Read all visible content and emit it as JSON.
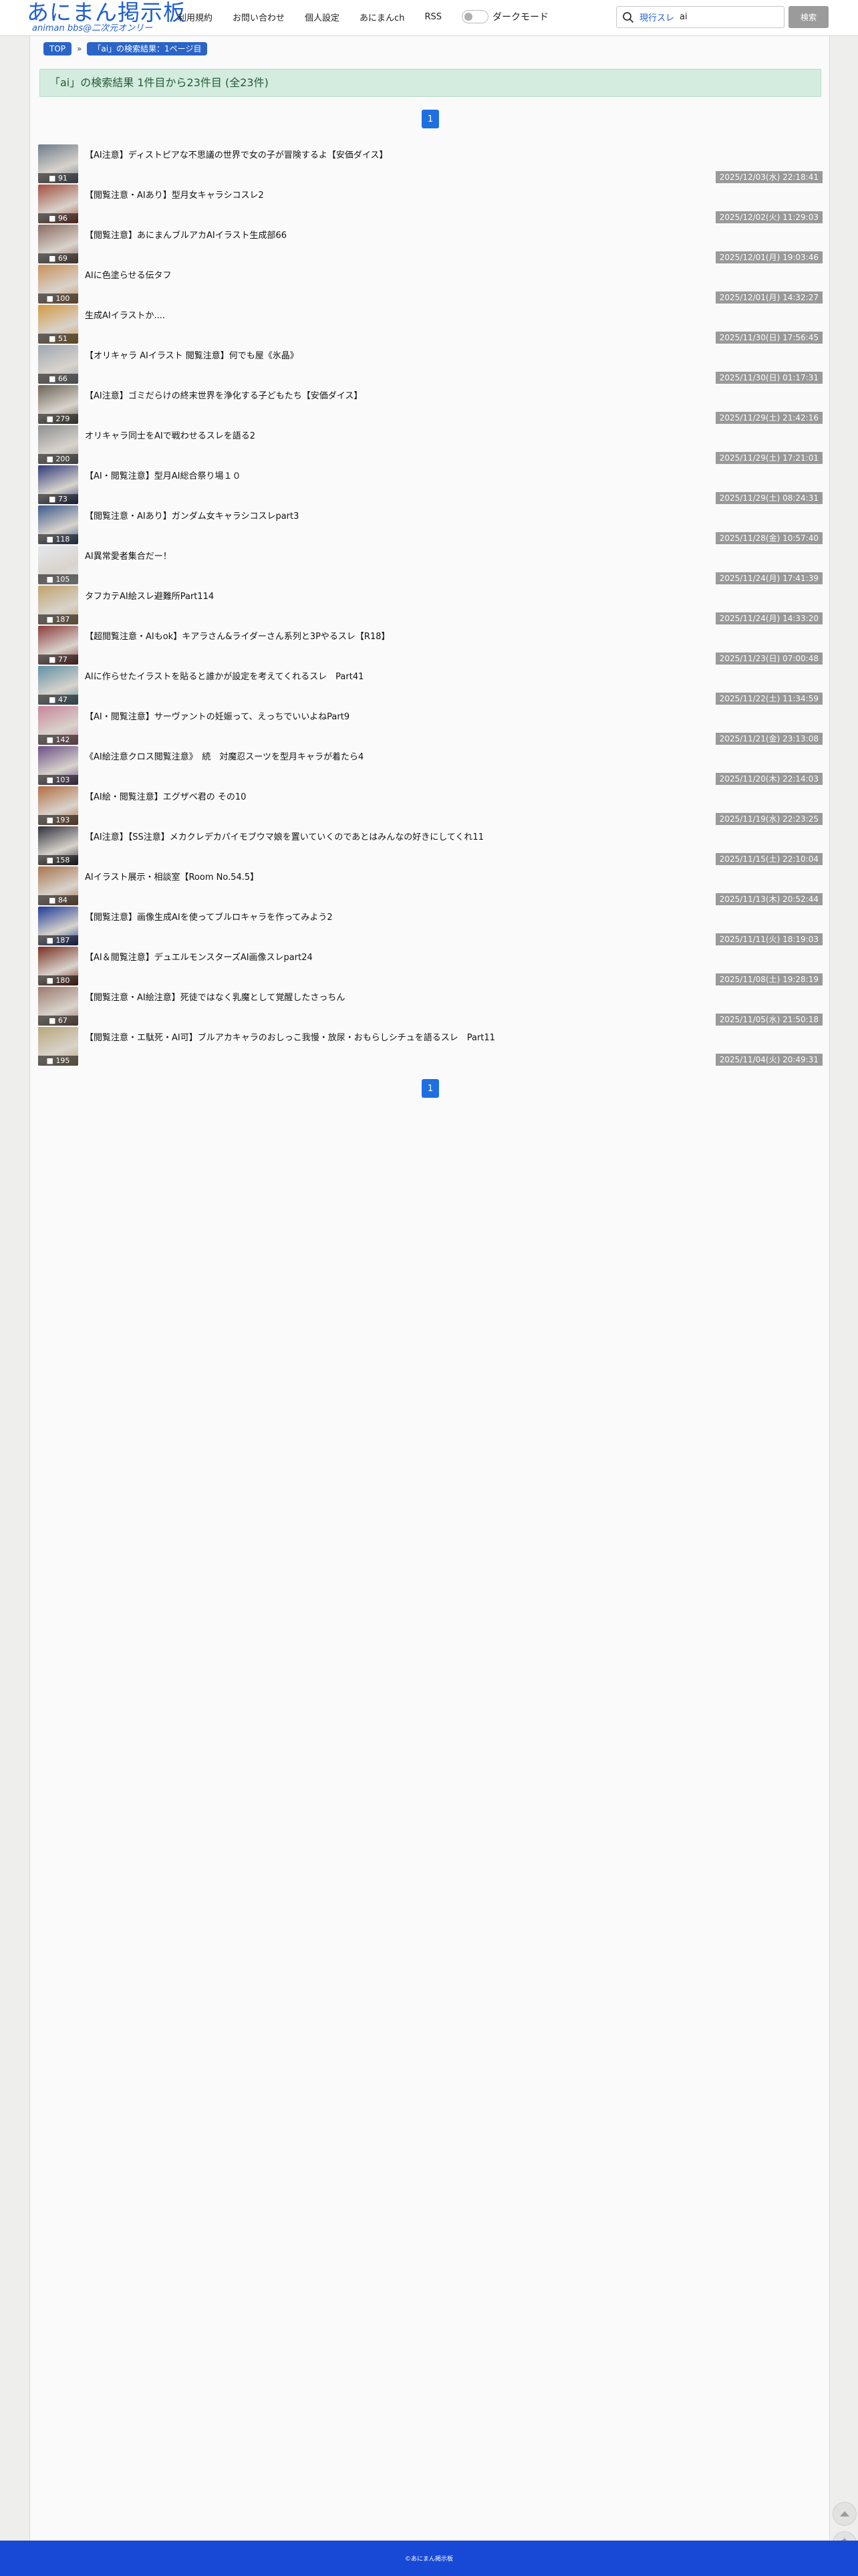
{
  "header": {
    "logo_main": "あにまん掲示板",
    "logo_sub": "animan bbs@二次元オンリー",
    "nav": [
      "利用規約",
      "お問い合わせ",
      "個人設定",
      "あにまんch",
      "RSS"
    ],
    "dark_mode_label": "ダークモード",
    "search": {
      "scope": "現行スレ",
      "value": "ai",
      "button": "検索"
    }
  },
  "breadcrumb": {
    "top": "TOP",
    "sep": "»",
    "current": "「ai」の検索結果：1ページ目"
  },
  "results_notice": "「ai」の検索結果 1件目から23件目 (全23件)",
  "pagination": {
    "current": "1"
  },
  "threads": [
    {
      "title": "【AI注意】ディストピアな不思議の世界で女の子が冒険するよ【安価ダイス】",
      "count": "91",
      "date": "2025/12/03(水) 22:18:41",
      "thumb": "#6f7c8a"
    },
    {
      "title": "【閲覧注意・AIあり】型月女キャラシコスレ2",
      "count": "96",
      "date": "2025/12/02(火) 11:29:03",
      "thumb": "#a24f3f"
    },
    {
      "title": "【閲覧注意】あにまんブルアカAIイラスト生成部66",
      "count": "69",
      "date": "2025/12/01(月) 19:03:46",
      "thumb": "#8a6b62"
    },
    {
      "title": "AIに色塗らせる伝タフ",
      "count": "100",
      "date": "2025/12/01(月) 14:32:27",
      "thumb": "#c9915c"
    },
    {
      "title": "生成AIイラストか....",
      "count": "51",
      "date": "2025/11/30(日) 17:56:45",
      "thumb": "#d59a44"
    },
    {
      "title": "【オリキャラ AIイラスト 閲覧注意】何でも屋《氷晶》",
      "count": "66",
      "date": "2025/11/30(日) 01:17:31",
      "thumb": "#9fa7b1"
    },
    {
      "title": "【AI注意】ゴミだらけの終末世界を浄化する子どもたち【安価ダイス】",
      "count": "279",
      "date": "2025/11/29(土) 21:42:16",
      "thumb": "#6d6457"
    },
    {
      "title": "オリキャラ同士をAIで戦わせるスレを語る2",
      "count": "200",
      "date": "2025/11/29(土) 17:21:01",
      "thumb": "#8e8f92"
    },
    {
      "title": "【AI・閲覧注意】型月AI総合祭り場１０",
      "count": "73",
      "date": "2025/11/29(土) 08:24:31",
      "thumb": "#2f3b7a"
    },
    {
      "title": "【閲覧注意・AIあり】ガンダム女キャラシコスレpart3",
      "count": "118",
      "date": "2025/11/28(金) 10:57:40",
      "thumb": "#3c5a8c"
    },
    {
      "title": "AI異常愛者集合だー！",
      "count": "105",
      "date": "2025/11/24(月) 17:41:39",
      "thumb": "#e6e9ee"
    },
    {
      "title": "タフカテAI絵スレ避難所Part114",
      "count": "187",
      "date": "2025/11/24(月) 14:33:20",
      "thumb": "#c1a36c"
    },
    {
      "title": "【超閲覧注意・AIもok】キアラさん&ライダーさん系列と3Pやるスレ【R18】",
      "count": "77",
      "date": "2025/11/23(日) 07:00:48",
      "thumb": "#8c3c3c"
    },
    {
      "title": "AIに作らせたイラストを貼ると誰かが設定を考えてくれるスレ　Part41",
      "count": "47",
      "date": "2025/11/22(土) 11:34:59",
      "thumb": "#5f90a6"
    },
    {
      "title": "【AI・閲覧注意】サーヴァントの妊娠って、えっちでいいよねPart9",
      "count": "142",
      "date": "2025/11/21(金) 23:13:08",
      "thumb": "#c8849a"
    },
    {
      "title": "《AI絵注意クロス閲覧注意》　続　対魔忍スーツを型月キャラが着たら4",
      "count": "103",
      "date": "2025/11/20(木) 22:14:03",
      "thumb": "#6b4f86"
    },
    {
      "title": "【AI絵・閲覧注意】エグザベ君の その10",
      "count": "193",
      "date": "2025/11/19(水) 22:23:25",
      "thumb": "#b26d43"
    },
    {
      "title": "【AI注意】【SS注意】メカクレデカパイモブウマ娘を置いていくのであとはみんなの好きにしてくれ11",
      "count": "158",
      "date": "2025/11/15(土) 22:10:04",
      "thumb": "#2d2f3a"
    },
    {
      "title": "AIイラスト展示・相談室【Room No.54.5】",
      "count": "84",
      "date": "2025/11/13(木) 20:52:44",
      "thumb": "#a8754e"
    },
    {
      "title": "【閲覧注意】画像生成AIを使ってブルロキャラを作ってみよう2",
      "count": "187",
      "date": "2025/11/11(火) 18:19:03",
      "thumb": "#1e3b9a"
    },
    {
      "title": "【AI＆閲覧注意】デュエルモンスターズAI画像スレpart24",
      "count": "180",
      "date": "2025/11/08(土) 19:28:19",
      "thumb": "#7a2f22"
    },
    {
      "title": "【閲覧注意・AI絵注意】死徒ではなく乳魔として覚醒したさっちん",
      "count": "67",
      "date": "2025/11/05(水) 21:50:18",
      "thumb": "#9d7a6e"
    },
    {
      "title": "【閲覧注意・エ駄死・AI可】ブルアカキャラのおしっこ我慢・放尿・おもらしシチュを語るスレ　Part11",
      "count": "195",
      "date": "2025/11/04(火) 20:49:31",
      "thumb": "#b9a77a"
    }
  ],
  "footer": "©あにまん掲示板"
}
